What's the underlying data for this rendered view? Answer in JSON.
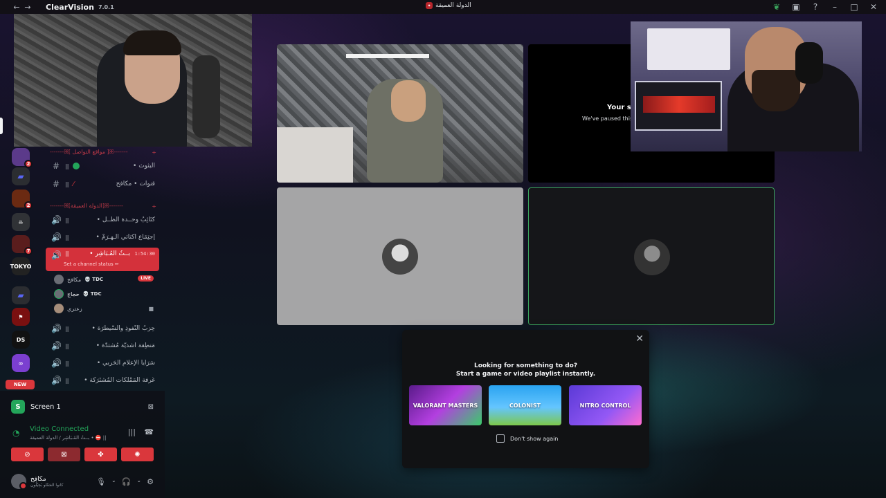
{
  "app": {
    "name": "ClearVision",
    "version": "7.0.1",
    "server_title": "الدولة العميقة"
  },
  "titlebar": {
    "icons": [
      "back-icon",
      "forward-icon",
      "leaf-icon",
      "inbox-icon",
      "help-icon",
      "minimize-icon",
      "maximize-icon",
      "close-icon"
    ]
  },
  "server_rail": {
    "badges": [
      "2",
      "2",
      "7"
    ],
    "new_label": "NEW",
    "icon_labels": [
      "TOKYO",
      "DS"
    ]
  },
  "channels": {
    "categories": [
      {
        "label": "-------ꕤ[ مواقع التواصل ]ꕤ-------",
        "add": "+"
      },
      {
        "label": "-------ꕤ[الدولة العميقة]ꕤ-------",
        "add": "+"
      }
    ],
    "text_channels": [
      {
        "label": "البثوث •",
        "glyph": "#"
      },
      {
        "label": "قنوات • مكافح",
        "glyph": "#"
      }
    ],
    "voice_channels": [
      {
        "label": "كَتَائِبُ وحــدة الظــل •",
        "glyph": "🔊"
      },
      {
        "label": "إجتِمَاع أُكتاتي الـهـرَمْ •",
        "glyph": "🔊"
      },
      {
        "label": "بــثُ المُـبَاشِر •",
        "glyph": "🔊",
        "timer": "1:54:30",
        "status": "Set a channel status ✏"
      },
      {
        "label": "حِزبُ النُّفوذِ والسَّيطَرَة •",
        "glyph": "🔊"
      },
      {
        "label": "مَنطِقة أشديّة مُشتدّة •",
        "glyph": "🔊"
      },
      {
        "label": "سَرَايا الإعلامِ الحَربي •",
        "glyph": "🔊"
      },
      {
        "label": "غُرفة المَمْلكات المُشتَرَكة •",
        "glyph": "🔊"
      }
    ],
    "voice_users": [
      {
        "name": "مكافح",
        "tag": "💀 TDC",
        "live": "LIVE"
      },
      {
        "name": "حجاج",
        "tag": "💀 TDC"
      },
      {
        "name": "زعتري"
      }
    ]
  },
  "bottom_panel": {
    "screen_label": "Screen 1",
    "screen_icon_letter": "S",
    "vc_status": "Video Connected",
    "vc_sub": "بــثُ المُـبَاشِر / الدولة العميقة • ⛔ ||",
    "user_name": "مكافح",
    "user_sub": "كانوا الشتّلو بَحِيْلُون"
  },
  "tiles": {
    "paused_title": "Your st",
    "paused_sub": "We've paused this"
  },
  "activity": {
    "title_line1": "Looking for something to do?",
    "title_line2": "Start a game or video playlist instantly.",
    "games": [
      "VALORANT MASTERS",
      "COLONIST",
      "NITRO CONTROL"
    ],
    "dont_show": "Don't show again"
  },
  "colors": {
    "accent_red": "#d4313b",
    "connected_green": "#23a55a",
    "category_red": "#c23a48"
  }
}
